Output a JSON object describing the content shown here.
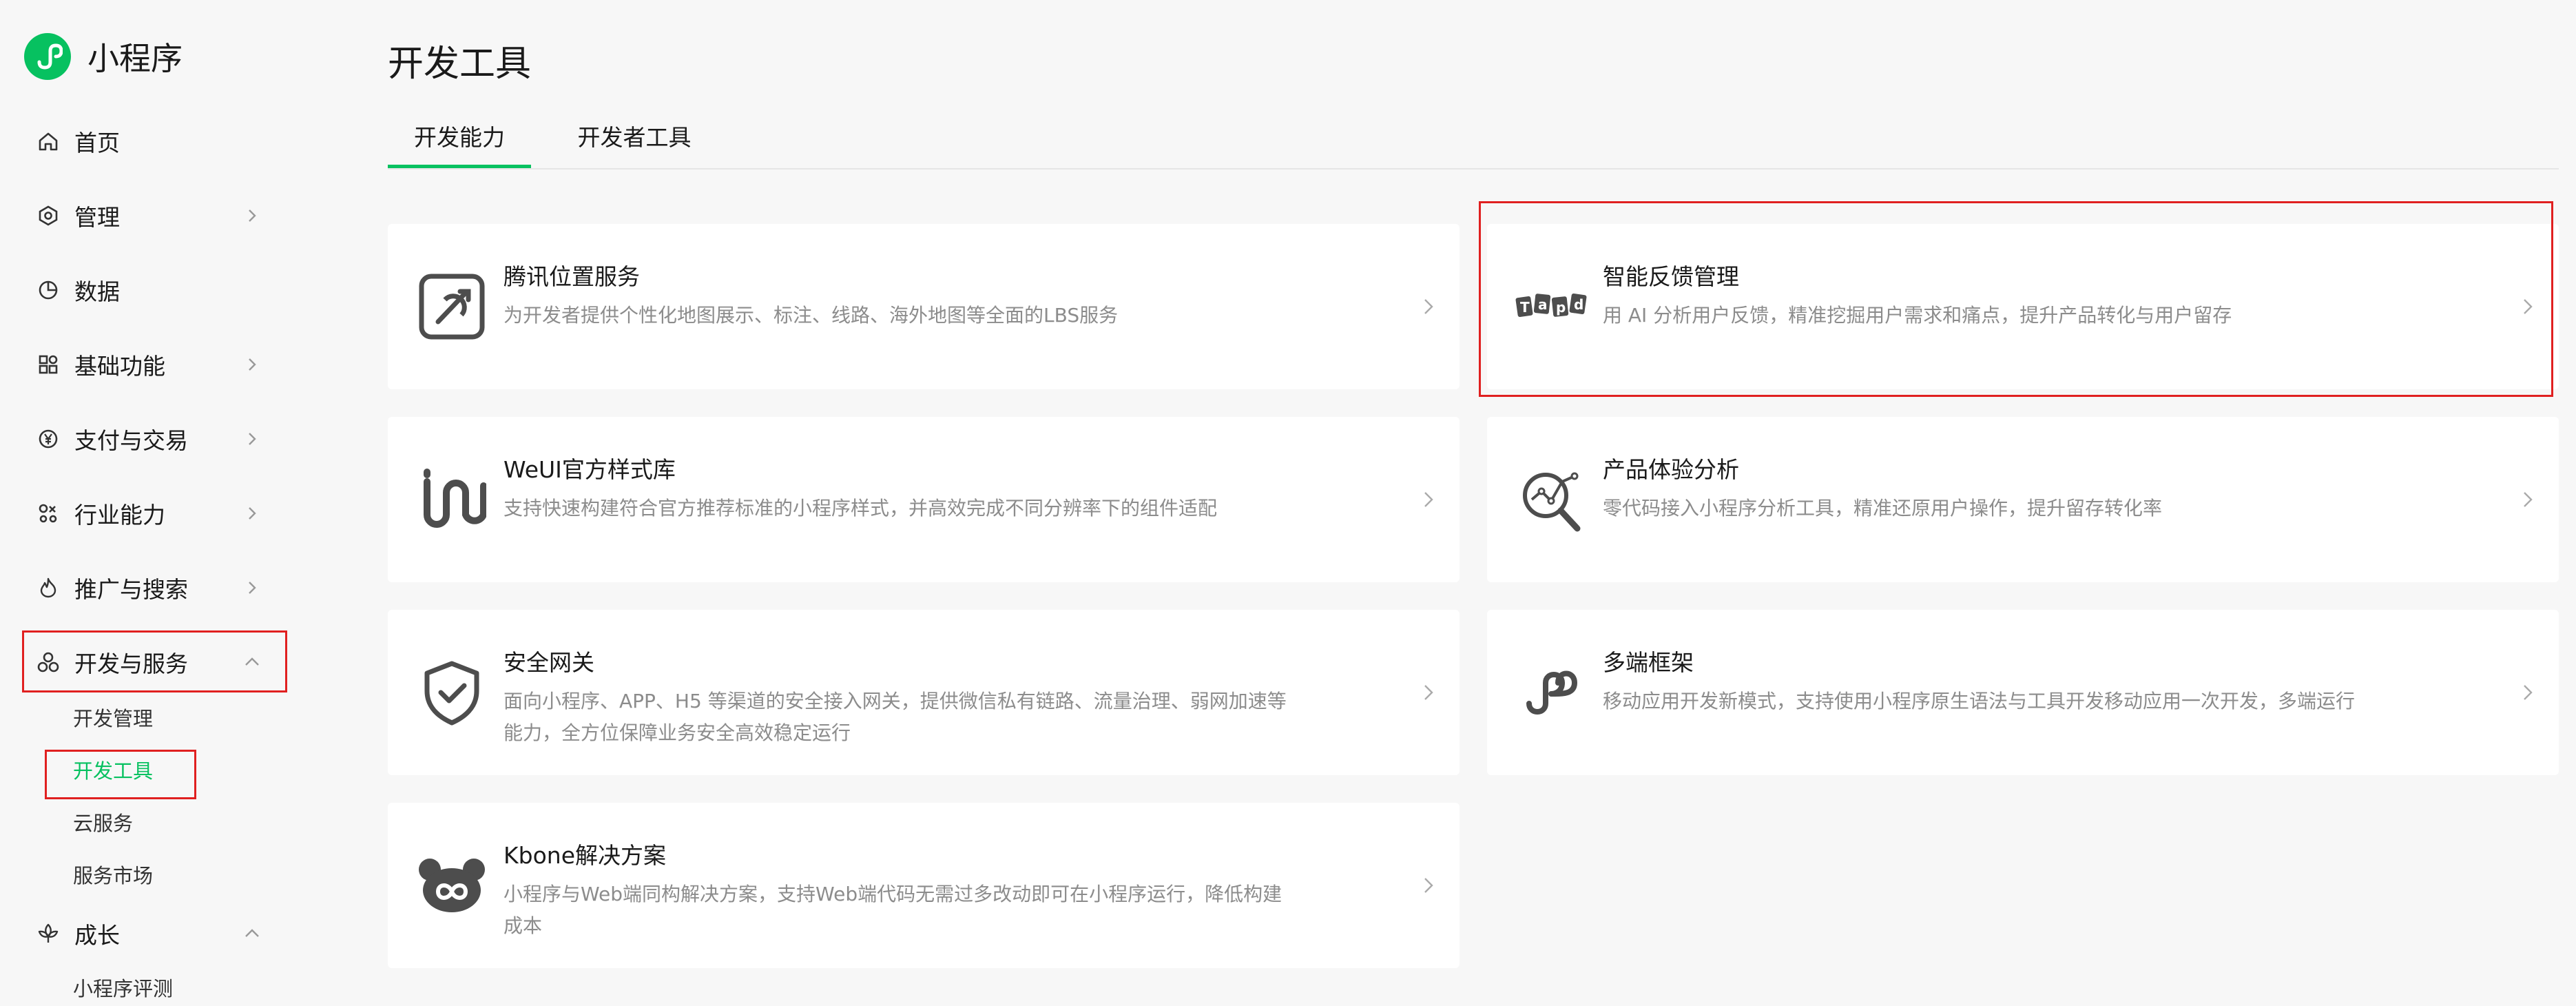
{
  "brand": {
    "name": "小程序",
    "logo_icon": "miniprogram-logo-icon",
    "accent": "#07c160"
  },
  "sidebar": {
    "items": [
      {
        "label": "首页",
        "icon": "home-icon"
      },
      {
        "label": "管理",
        "icon": "hexagon-settings-icon"
      },
      {
        "label": "数据",
        "icon": "pie-chart-icon"
      },
      {
        "label": "基础功能",
        "icon": "grid-icon"
      },
      {
        "label": "支付与交易",
        "icon": "yuan-icon"
      },
      {
        "label": "行业能力",
        "icon": "industry-icon"
      },
      {
        "label": "推广与搜索",
        "icon": "flame-icon"
      },
      {
        "label": "开发与服务",
        "icon": "circles-icon"
      }
    ],
    "dev_sub": [
      {
        "label": "开发管理"
      },
      {
        "label": "开发工具",
        "active": true
      },
      {
        "label": "云服务"
      },
      {
        "label": "服务市场"
      }
    ],
    "growth": {
      "label": "成长",
      "icon": "growth-icon"
    },
    "growth_sub": [
      {
        "label": "小程序评测"
      }
    ]
  },
  "main": {
    "title": "开发工具",
    "tabs": [
      {
        "label": "开发能力",
        "active": true
      },
      {
        "label": "开发者工具"
      }
    ],
    "cards": [
      {
        "title": "腾讯位置服务",
        "desc": "为开发者提供个性化地图展示、标注、线路、海外地图等全面的LBS服务",
        "icon": "location-service-icon"
      },
      {
        "title": "智能反馈管理",
        "desc": "用 AI 分析用户反馈，精准挖掘用户需求和痛点，提升产品转化与用户留存",
        "icon": "tapd-icon"
      },
      {
        "title": "WeUI官方样式库",
        "desc": "支持快速构建符合官方推荐标准的小程序样式，并高效完成不同分辨率下的组件适配",
        "icon": "weui-icon"
      },
      {
        "title": "产品体验分析",
        "desc": "零代码接入小程序分析工具，精准还原用户操作，提升留存转化率",
        "icon": "analysis-icon"
      },
      {
        "title": "安全网关",
        "desc": "面向小程序、APP、H5 等渠道的安全接入网关，提供微信私有链路、流量治理、弱网加速等能力，全方位保障业务安全高效稳定运行",
        "icon": "shield-icon"
      },
      {
        "title": "多端框架",
        "desc": "移动应用开发新模式，支持使用小程序原生语法与工具开发移动应用一次开发，多端运行",
        "icon": "multi-platform-icon"
      },
      {
        "title": "Kbone解决方案",
        "desc": "小程序与Web端同构解决方案，支持Web端代码无需过多改动即可在小程序运行，降低构建成本",
        "icon": "kbone-icon"
      }
    ]
  },
  "colors": {
    "highlight": "#e02020",
    "icon_gray": "#4d4d4d"
  }
}
